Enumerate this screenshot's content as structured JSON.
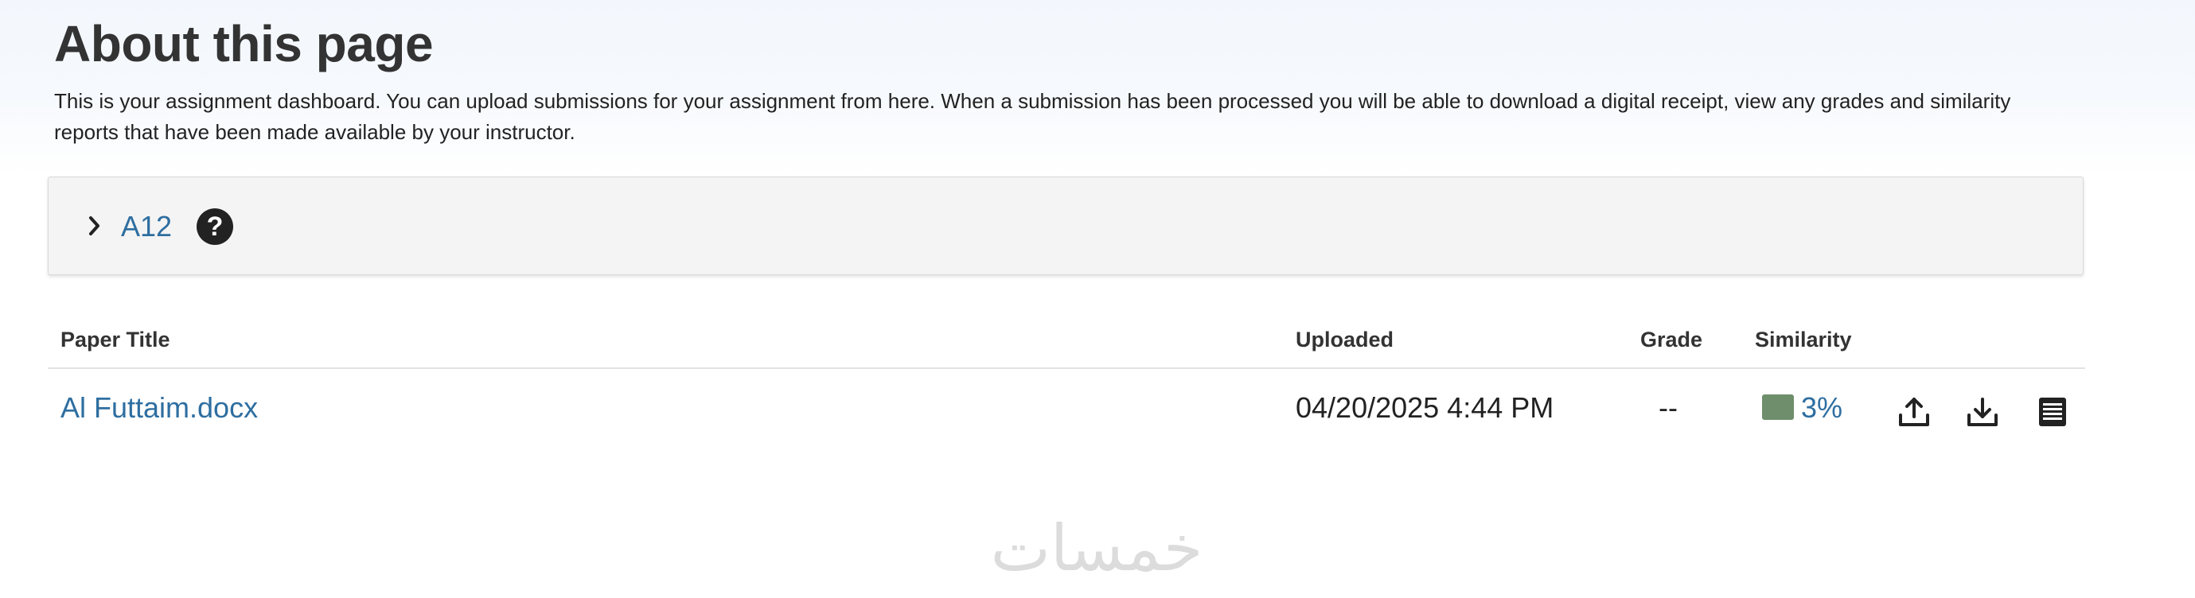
{
  "header": {
    "title": "About this page",
    "description": "This is your assignment dashboard. You can upload submissions for your assignment from here. When a submission has been processed you will be able to download a digital receipt, view any grades and similarity reports that have been made available by your instructor."
  },
  "assignment": {
    "name": "A12",
    "help_glyph": "?",
    "toggle_icon": "chevron-right-icon"
  },
  "table": {
    "headers": {
      "paper_title": "Paper Title",
      "uploaded": "Uploaded",
      "grade": "Grade",
      "similarity": "Similarity"
    },
    "rows": [
      {
        "paper_title": "Al Futtaim.docx",
        "uploaded": "04/20/2025 4:44 PM",
        "grade": "--",
        "similarity": "3%",
        "similarity_color": "#6f8f6c",
        "actions": [
          "upload-icon",
          "download-icon",
          "report-icon"
        ]
      }
    ]
  },
  "watermark": {
    "text": "خمسات"
  },
  "colors": {
    "link": "#2e6ea0",
    "accordion_bg": "#f4f4f4",
    "similarity_swatch": "#6f8f6c"
  }
}
